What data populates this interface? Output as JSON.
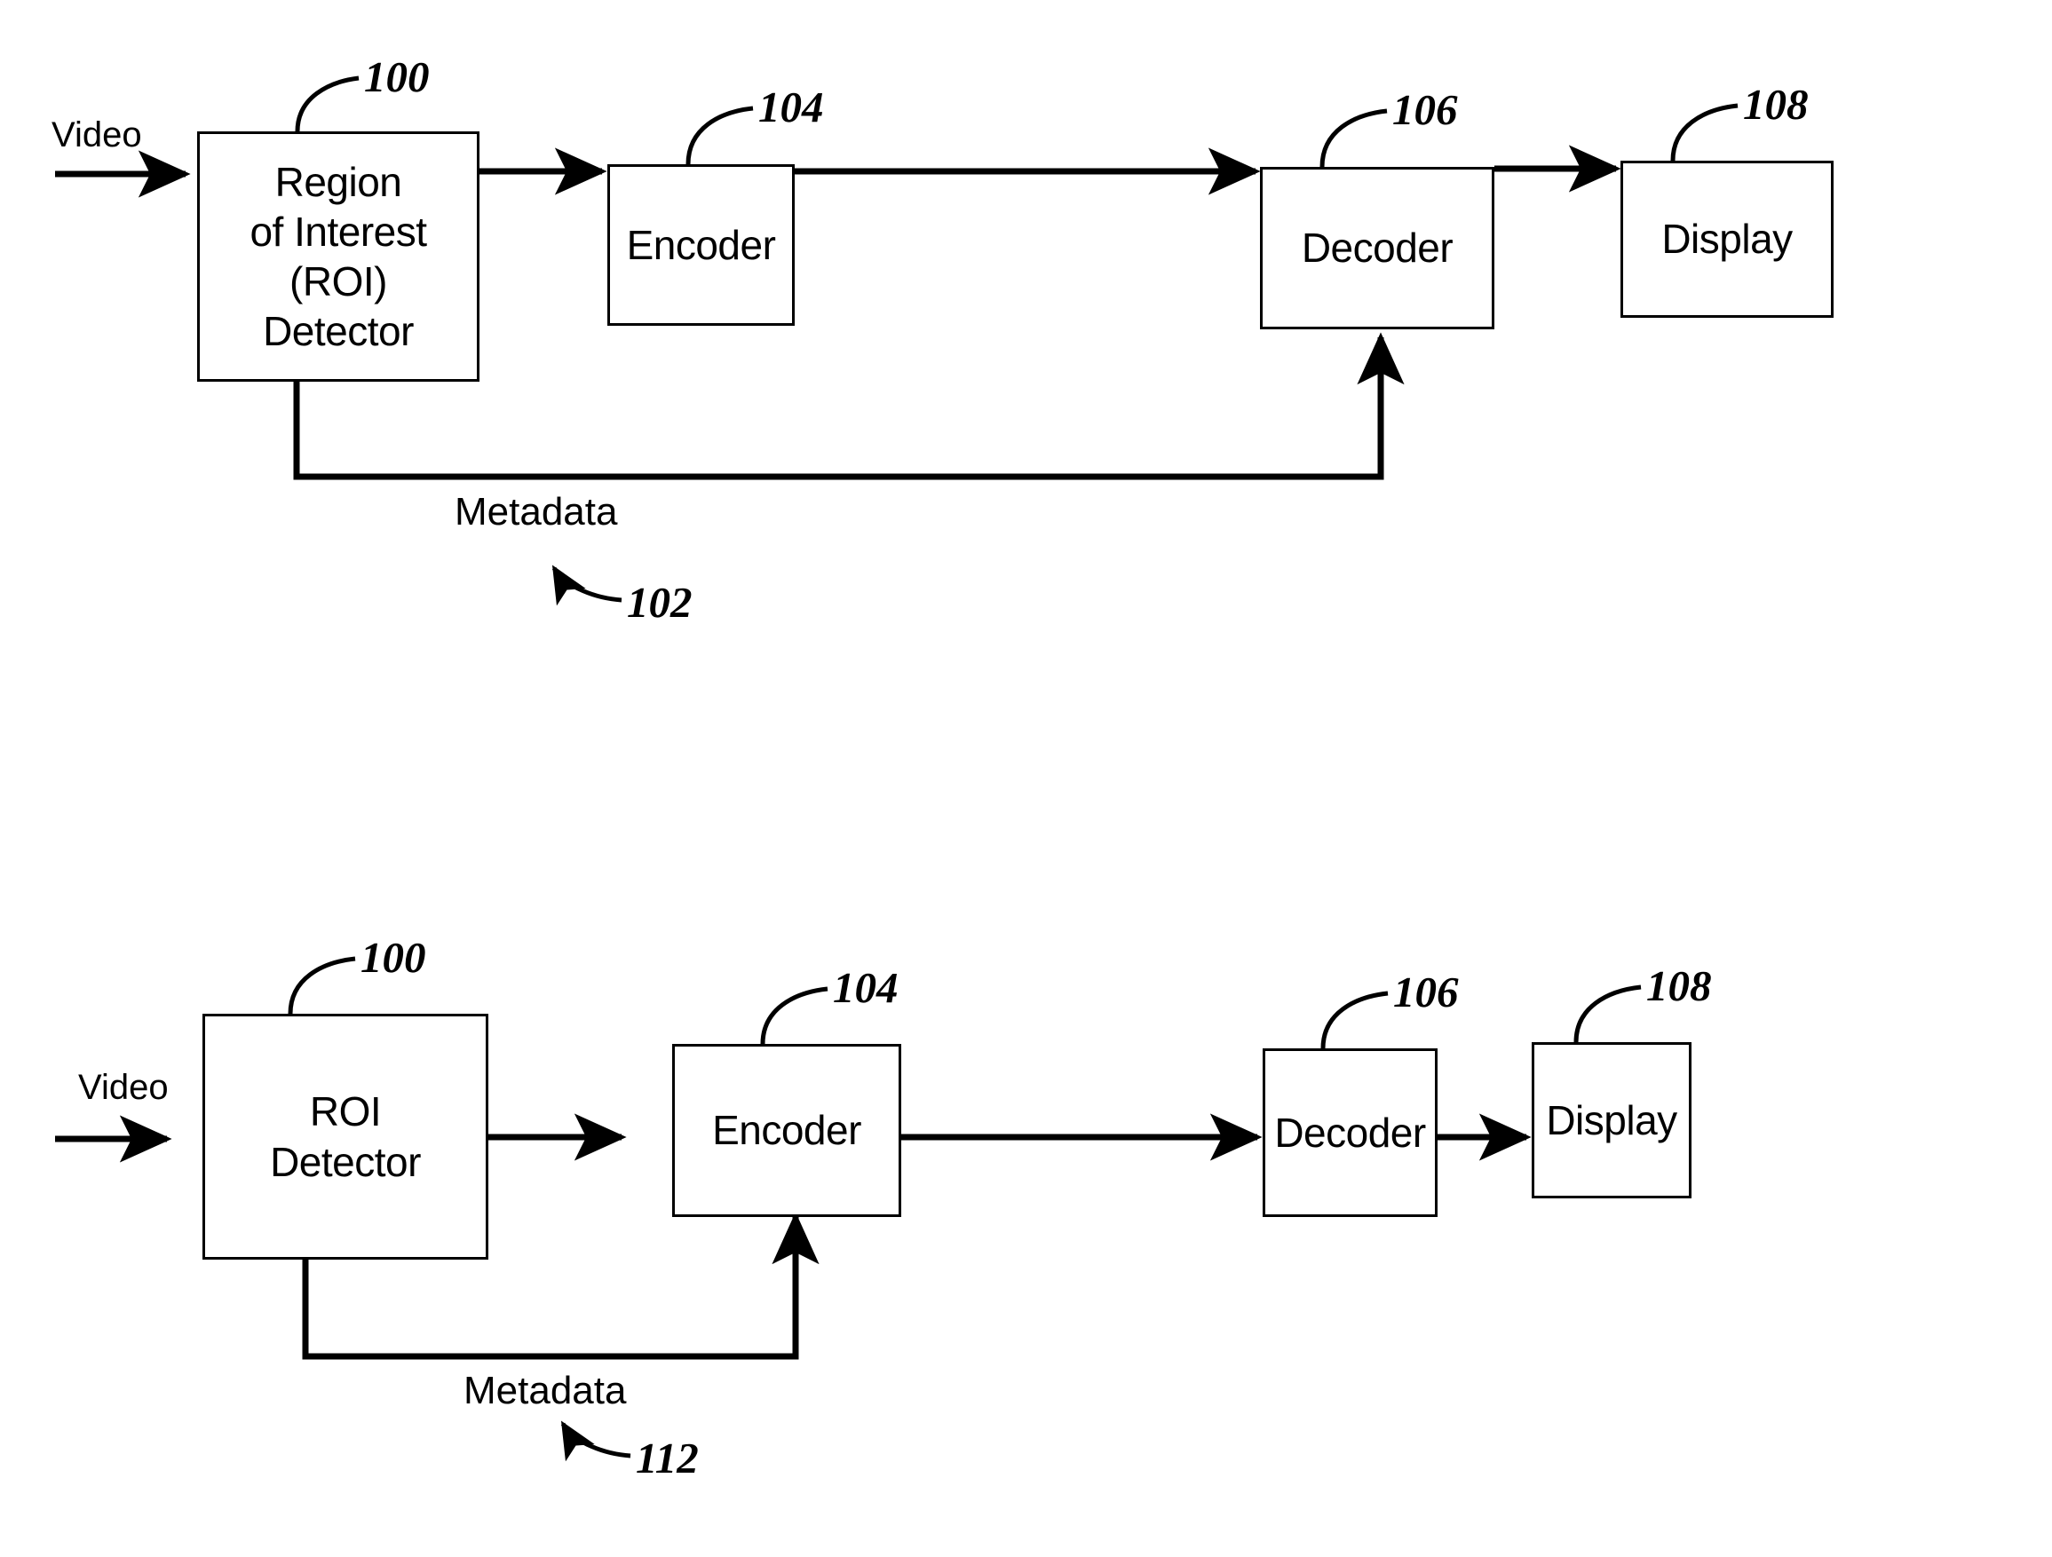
{
  "figure": {
    "type": "patent-block-diagram",
    "background_color": "#ffffff",
    "line_color": "#000000"
  },
  "diagrams": [
    {
      "id": "figure-upper",
      "boxes": [
        {
          "key": "roi_detector",
          "label": "Region\nof Interest\n(ROI)\nDetector",
          "ref": "100"
        },
        {
          "key": "encoder",
          "label": "Encoder",
          "ref": "104"
        },
        {
          "key": "decoder",
          "label": "Decoder",
          "ref": "106"
        },
        {
          "key": "display",
          "label": "Display",
          "ref": "108"
        }
      ],
      "labels": {
        "input": "Video",
        "metadata": "Metadata",
        "metadata_ref": "102"
      }
    },
    {
      "id": "figure-lower",
      "boxes": [
        {
          "key": "roi_detector",
          "label": "ROI\nDetector",
          "ref": "100"
        },
        {
          "key": "encoder",
          "label": "Encoder",
          "ref": "104"
        },
        {
          "key": "decoder",
          "label": "Decoder",
          "ref": "106"
        },
        {
          "key": "display",
          "label": "Display",
          "ref": "108"
        }
      ],
      "labels": {
        "input": "Video",
        "metadata": "Metadata",
        "metadata_ref": "112"
      }
    }
  ]
}
